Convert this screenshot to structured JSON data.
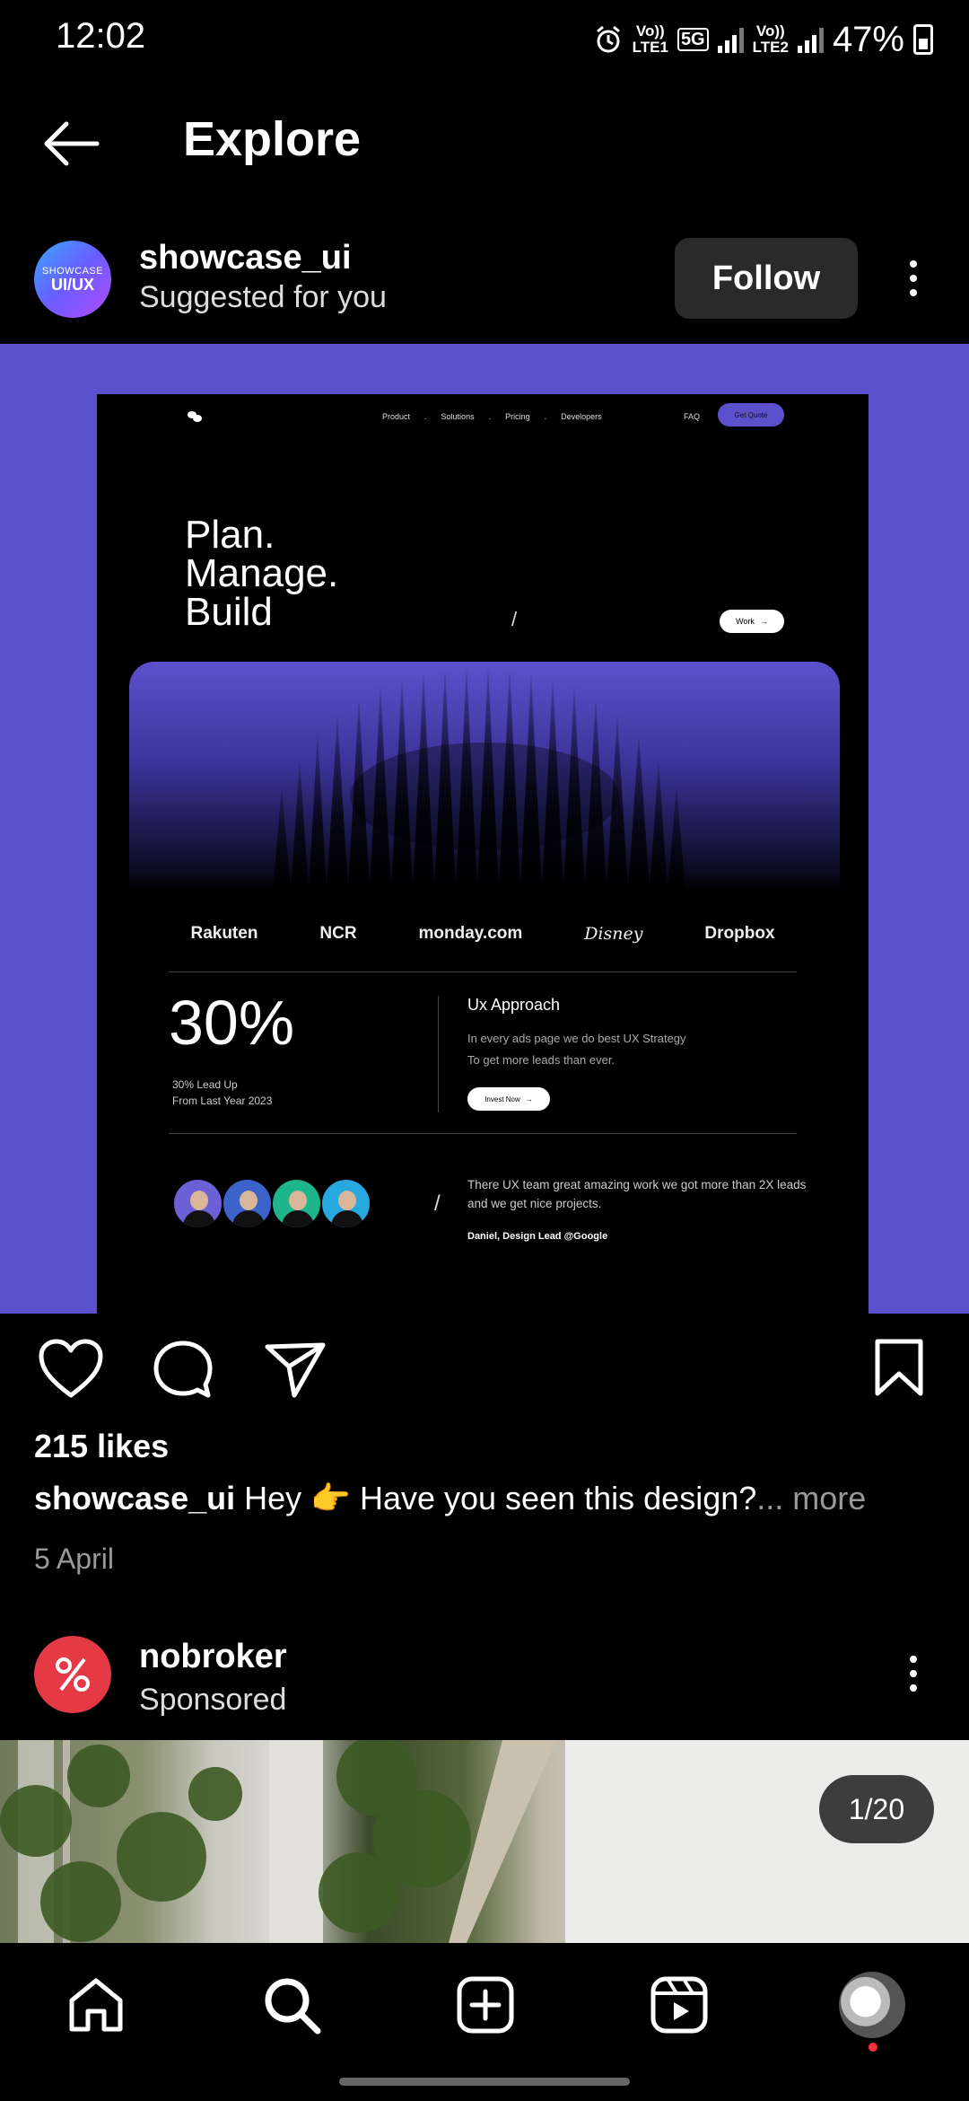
{
  "status_bar": {
    "time": "12:02",
    "sim1_top": "Vo))",
    "sim1_bottom": "LTE1",
    "net": "5G",
    "sim2_top": "Vo))",
    "sim2_bottom": "LTE2",
    "battery": "47%"
  },
  "header": {
    "title": "Explore"
  },
  "post": {
    "avatar_line1": "SHOWCASE",
    "avatar_line2": "UI/UX",
    "username": "showcase_ui",
    "subtitle": "Suggested for you",
    "follow_label": "Follow",
    "likes": "215 likes",
    "caption_user": "showcase_ui",
    "caption_text": "Hey 👉 Have you seen this design?",
    "caption_more": "... more",
    "date": "5 April",
    "image": {
      "nav": [
        "Product",
        "Solutions",
        "Pricing",
        "Developers"
      ],
      "faq": "FAQ",
      "get_quote": "Get Quote",
      "hero_1": "Plan.",
      "hero_2": "Manage.",
      "hero_3": "Build",
      "slash": "/",
      "work_btn": "Work",
      "logos": [
        "Rakuten",
        "NCR",
        "monday.com",
        "Disney",
        "Dropbox"
      ],
      "stat": "30%",
      "stat_sub1": "30% Lead Up",
      "stat_sub2": "From Last Year 2023",
      "ux_title": "Ux Approach",
      "ux_line1": "In every ads page we do best UX Strategy",
      "ux_line2": "To get more leads than ever.",
      "invest_btn": "Invest Now",
      "testimonial": "There UX team great amazing work we got more than 2X leads and we get nice projects.",
      "signature": "Daniel, Design Lead @Google"
    }
  },
  "sponsored": {
    "username": "nobroker",
    "subtitle": "Sponsored",
    "page_indicator": "1/20"
  },
  "colors": {
    "post_bg": "#5b51cc",
    "follow_bg": "#2a2a2a",
    "sponsor_avatar": "#e53946"
  },
  "bottom_nav": [
    "home-icon",
    "search-icon",
    "create-icon",
    "reels-icon",
    "profile-avatar"
  ]
}
